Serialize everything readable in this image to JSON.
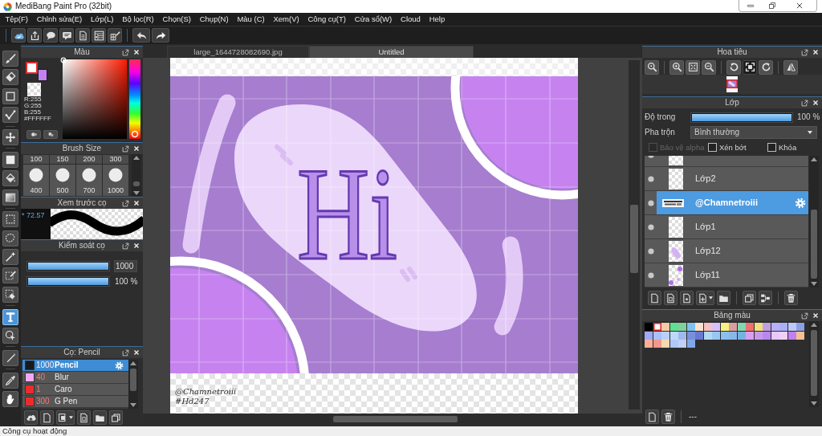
{
  "window": {
    "title": "MediBang Paint Pro (32bit)"
  },
  "menu": [
    "Tệp(F)",
    "Chỉnh sửa(E)",
    "Lớp(L)",
    "Bộ lọc(R)",
    "Chọn(S)",
    "Chụp(N)",
    "Màu (C)",
    "Xem(V)",
    "Công cụ(T)",
    "Cửa sổ(W)",
    "Cloud",
    "Help"
  ],
  "tools": [
    [
      {
        "selected": false
      },
      {
        "selected": false
      },
      {
        "selected": false
      },
      {
        "selected": false
      }
    ],
    [
      {
        "selected": false
      }
    ],
    [
      {
        "selected": false
      },
      {
        "selected": false
      },
      {
        "selected": false
      }
    ],
    [
      {
        "selected": false
      },
      {
        "selected": false
      },
      {
        "selected": false
      },
      {
        "selected": false
      },
      {
        "selected": false
      }
    ],
    [
      {
        "selected": true
      },
      {
        "selected": false
      }
    ],
    [
      {
        "selected": false
      }
    ],
    [
      {
        "selected": false
      },
      {
        "selected": false
      }
    ]
  ],
  "color_panel": {
    "title": "Màu",
    "current_colors": [
      {
        "color": "#ffffff",
        "selected": true
      },
      {
        "color": "#c482f0",
        "selected": false
      }
    ],
    "readout": [
      "R:255",
      "G:255",
      "B:255"
    ],
    "hex": "#FFFFFF"
  },
  "brush_size": {
    "title": "Brush Size",
    "top_row": [
      "100",
      "150",
      "200",
      "300"
    ],
    "bottom_row": [
      "400",
      "500",
      "700",
      "1000"
    ]
  },
  "brush_preview": {
    "title": "Xem trước cọ",
    "reading": "* 72.57"
  },
  "brush_control": {
    "title": "Kiểm soát cọ",
    "sliders": [
      {
        "kind": "field",
        "level": 1,
        "reading": "1000"
      },
      {
        "kind": "text",
        "level": 1,
        "reading": "100 %"
      }
    ]
  },
  "brush_list": {
    "title": "Cọ: Pencil",
    "items": [
      {
        "color": "#1a1a1a",
        "size": "1000",
        "name": "Pencil",
        "selected": true
      },
      {
        "color": "#f7a8f5",
        "size": "40",
        "name": "Blur",
        "selected": false
      },
      {
        "color": "#ee2b2b",
        "size": "1",
        "name": "Caro",
        "selected": false
      },
      {
        "color": "#ee2b2b",
        "size": "300",
        "name": "G Pen",
        "selected": false
      }
    ]
  },
  "canvas": {
    "tabs": [
      {
        "label": "large_1644728082690.jpg",
        "selected": false
      },
      {
        "label": "Untitled",
        "selected": true
      }
    ],
    "artwork": {
      "heading": "Hi",
      "signature": "@Chamnetroiii",
      "hashtag": "#Hd247"
    }
  },
  "navigator": {
    "title": "Hoa tiêu",
    "buttons": [
      {
        "selected": false
      },
      {
        "selected": false
      },
      {
        "selected": false
      },
      {
        "selected": false
      },
      {
        "selected": false
      },
      {
        "selected": true
      },
      {
        "selected": false
      },
      {
        "selected": false
      }
    ]
  },
  "layers": {
    "title": "Lớp",
    "opacity": {
      "label": "Độ trong",
      "level": 1,
      "reading": "100 %"
    },
    "blend": {
      "label": "Pha trộn",
      "value": "Bình thường"
    },
    "options": [
      {
        "label": "Bảo vệ alpha",
        "checked": false,
        "disabled": true
      },
      {
        "label": "Xén bớt",
        "checked": false,
        "disabled": false
      },
      {
        "label": "Khóa",
        "checked": false,
        "disabled": false
      }
    ],
    "items": [
      {
        "visible": true,
        "selected": false
      },
      {
        "name": "Lớp2",
        "visible": true,
        "selected": false
      },
      {
        "name": "@Chamnetroiii",
        "visible": true,
        "selected": true
      },
      {
        "name": "Lớp1",
        "visible": true,
        "selected": false
      },
      {
        "name": "Lớp12",
        "visible": true,
        "selected": false
      },
      {
        "name": "Lớp11",
        "visible": true,
        "selected": false
      }
    ]
  },
  "palette": {
    "title": "Bảng màu",
    "swatches": [
      {
        "color": "#000000",
        "selected": false
      },
      {
        "color": "#ffffff",
        "selected": true
      },
      {
        "color": "#f8c8a8",
        "selected": false
      },
      {
        "color": "#60e090",
        "selected": false
      },
      {
        "color": "#80d0a0",
        "selected": false
      },
      {
        "color": "#80c0f0",
        "selected": false
      },
      {
        "color": "#fce0d0",
        "selected": false
      },
      {
        "color": "#f8c0c0",
        "selected": false
      },
      {
        "color": "#d8c0f8",
        "selected": false
      },
      {
        "color": "#f8f080",
        "selected": false
      },
      {
        "color": "#d8a0a0",
        "selected": false
      },
      {
        "color": "#80d8b0",
        "selected": false
      },
      {
        "color": "#f07070",
        "selected": false
      },
      {
        "color": "#f0e080",
        "selected": false
      },
      {
        "color": "#c0a0e0",
        "selected": false
      },
      {
        "color": "#b8b0f8",
        "selected": false
      },
      {
        "color": "#a8b0f8",
        "selected": false
      },
      {
        "color": "#c0c8f8",
        "selected": false
      },
      {
        "color": "#8ca0e8",
        "selected": false
      },
      {
        "color": "#a0a8f8",
        "selected": false
      },
      {
        "color": "#a8c0f8",
        "selected": false
      },
      {
        "color": "#b8d0f8",
        "selected": false
      },
      {
        "color": "#c0d8f8",
        "selected": false
      },
      {
        "color": "#a0b8f0",
        "selected": false
      },
      {
        "color": "#7890d8",
        "selected": false
      },
      {
        "color": "#6878d0",
        "selected": false
      },
      {
        "color": "#b0d8f0",
        "selected": false
      },
      {
        "color": "#98c8f0",
        "selected": false
      },
      {
        "color": "#88c0f0",
        "selected": false
      },
      {
        "color": "#88b8e8",
        "selected": false
      },
      {
        "color": "#78b0e0",
        "selected": false
      },
      {
        "color": "#d8a0f0",
        "selected": false
      },
      {
        "color": "#c898e8",
        "selected": false
      },
      {
        "color": "#b888f0",
        "selected": false
      },
      {
        "color": "#e8c8f8",
        "selected": false
      },
      {
        "color": "#f0d0f8",
        "selected": false
      },
      {
        "color": "#c080f0",
        "selected": false
      },
      {
        "color": "#f8c090",
        "selected": false
      },
      {
        "color": "#f8b098",
        "selected": false
      },
      {
        "color": "#f09890",
        "selected": false
      },
      {
        "color": "#f8d8b0",
        "selected": false
      },
      {
        "color": "#b0c8f8",
        "selected": false
      },
      {
        "color": "#c0d0f8",
        "selected": false
      },
      {
        "color": "#80a8e8",
        "selected": false
      }
    ],
    "footer": "---"
  },
  "status_bar": {
    "text": "Công cụ hoạt động"
  }
}
